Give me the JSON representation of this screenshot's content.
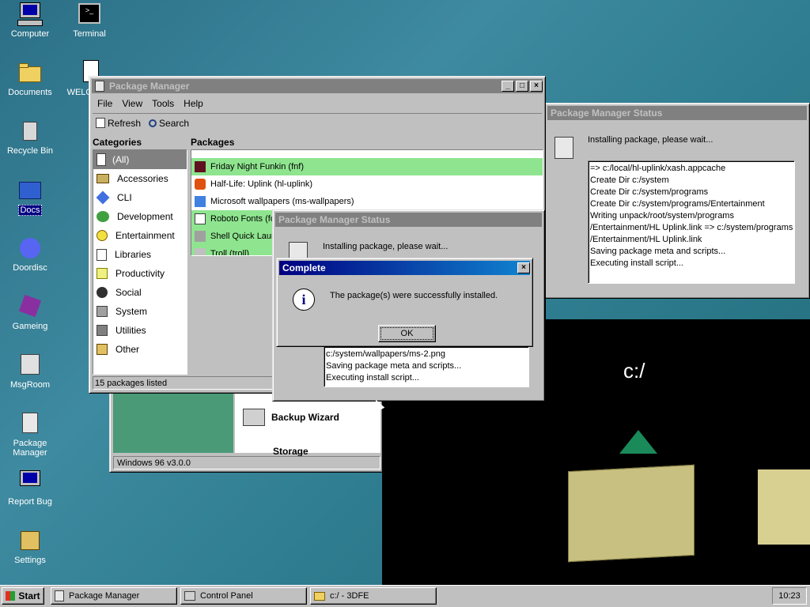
{
  "desktop_icons": [
    {
      "label": "Computer"
    },
    {
      "label": "Terminal"
    },
    {
      "label": "Documents"
    },
    {
      "label": "WELCOME"
    },
    {
      "label": "Recycle Bin"
    },
    {
      "label": "Docs"
    },
    {
      "label": "Doordisc"
    },
    {
      "label": "Gameing"
    },
    {
      "label": "MsgRoom"
    },
    {
      "label": "Package Manager"
    },
    {
      "label": "Report Bug"
    },
    {
      "label": "Settings"
    }
  ],
  "pm": {
    "title": "Package Manager",
    "menu": [
      "File",
      "View",
      "Tools",
      "Help"
    ],
    "refresh": "Refresh",
    "search": "Search",
    "categories_header": "Categories",
    "packages_header": "Packages",
    "categories": [
      "(All)",
      "Accessories",
      "CLI",
      "Development",
      "Entertainment",
      "Libraries",
      "Productivity",
      "Social",
      "System",
      "Utilities",
      "Other"
    ],
    "packages": [
      "Friday Night Funkin (fnf)",
      "Half-Life: Uplink (hl-uplink)",
      "Microsoft wallpapers (ms-wallpapers)",
      "Roboto Fonts (fo",
      "Shell Quick Laun",
      "Troll (troll)"
    ],
    "status": "15 packages listed"
  },
  "status_back": {
    "title": "Package Manager Status",
    "message": "Installing package, please wait...",
    "log": [
      "=> c:/local/hl-uplink/xash.appcache",
      "Create Dir c:/system",
      "Create Dir c:/system/programs",
      "Create Dir c:/system/programs/Entertainment",
      "Writing unpack/root/system/programs",
      "/Entertainment/HL Uplink.link => c:/system/programs",
      "/Entertainment/HL Uplink.link",
      "Saving package meta and scripts...",
      "Executing install script..."
    ]
  },
  "status_front": {
    "title": "Package Manager Status",
    "message": "Installing package, please wait...",
    "log": [
      "c:/system/wallpapers/ms-2.png",
      "Saving package meta and scripts...",
      "Executing install script..."
    ]
  },
  "dialog": {
    "title": "Complete",
    "message": "The package(s) were successfully installed.",
    "ok": "OK"
  },
  "control_panel": {
    "items": [
      "Backup Wizard",
      "Storage"
    ],
    "version": "Windows 96 v3.0.0"
  },
  "viewer": {
    "path": "c:/"
  },
  "taskbar": {
    "start": "Start",
    "tasks": [
      "Package Manager",
      "Control Panel",
      "c:/ - 3DFE"
    ],
    "clock": "10:23"
  },
  "colors": {
    "desktop": "#2f7d90",
    "titlebar_active": "#000080",
    "installed_highlight": "#8fe58f"
  }
}
